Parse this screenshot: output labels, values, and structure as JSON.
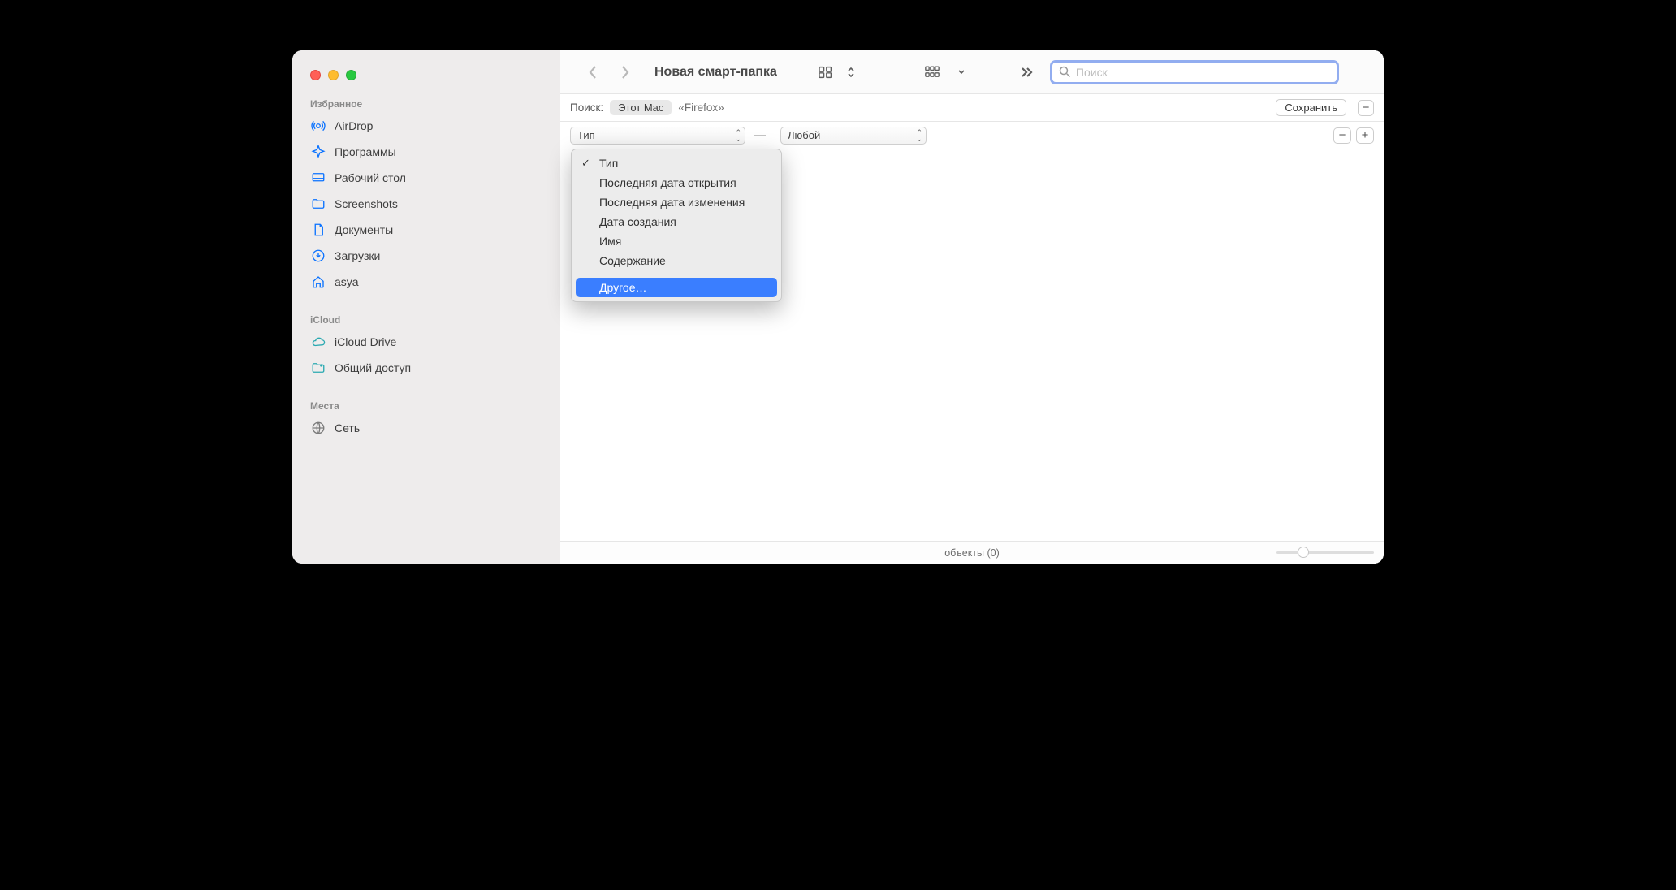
{
  "sidebar": {
    "sections": [
      {
        "label": "Избранное",
        "items": [
          {
            "key": "airdrop",
            "label": "AirDrop"
          },
          {
            "key": "apps",
            "label": "Программы"
          },
          {
            "key": "desktop",
            "label": "Рабочий стол"
          },
          {
            "key": "screenshots",
            "label": "Screenshots"
          },
          {
            "key": "documents",
            "label": "Документы"
          },
          {
            "key": "downloads",
            "label": "Загрузки"
          },
          {
            "key": "home",
            "label": "asya"
          }
        ]
      },
      {
        "label": "iCloud",
        "items": [
          {
            "key": "iclouddrive",
            "label": "iCloud Drive"
          },
          {
            "key": "shared",
            "label": "Общий доступ"
          }
        ]
      },
      {
        "label": "Места",
        "items": [
          {
            "key": "network",
            "label": "Сеть"
          }
        ]
      }
    ]
  },
  "toolbar": {
    "title": "Новая смарт-папка",
    "search_placeholder": "Поиск"
  },
  "scope": {
    "label": "Поиск:",
    "this_mac": "Этот Mac",
    "folder": "«Firefox»",
    "save": "Сохранить"
  },
  "criteria": {
    "attribute": "Тип",
    "value": "Любой",
    "menu": {
      "items": [
        {
          "label": "Тип",
          "checked": true
        },
        {
          "label": "Последняя дата открытия",
          "checked": false
        },
        {
          "label": "Последняя дата изменения",
          "checked": false
        },
        {
          "label": "Дата создания",
          "checked": false
        },
        {
          "label": "Имя",
          "checked": false
        },
        {
          "label": "Содержание",
          "checked": false
        }
      ],
      "other": "Другое…"
    }
  },
  "status": {
    "text": "объекты (0)"
  }
}
